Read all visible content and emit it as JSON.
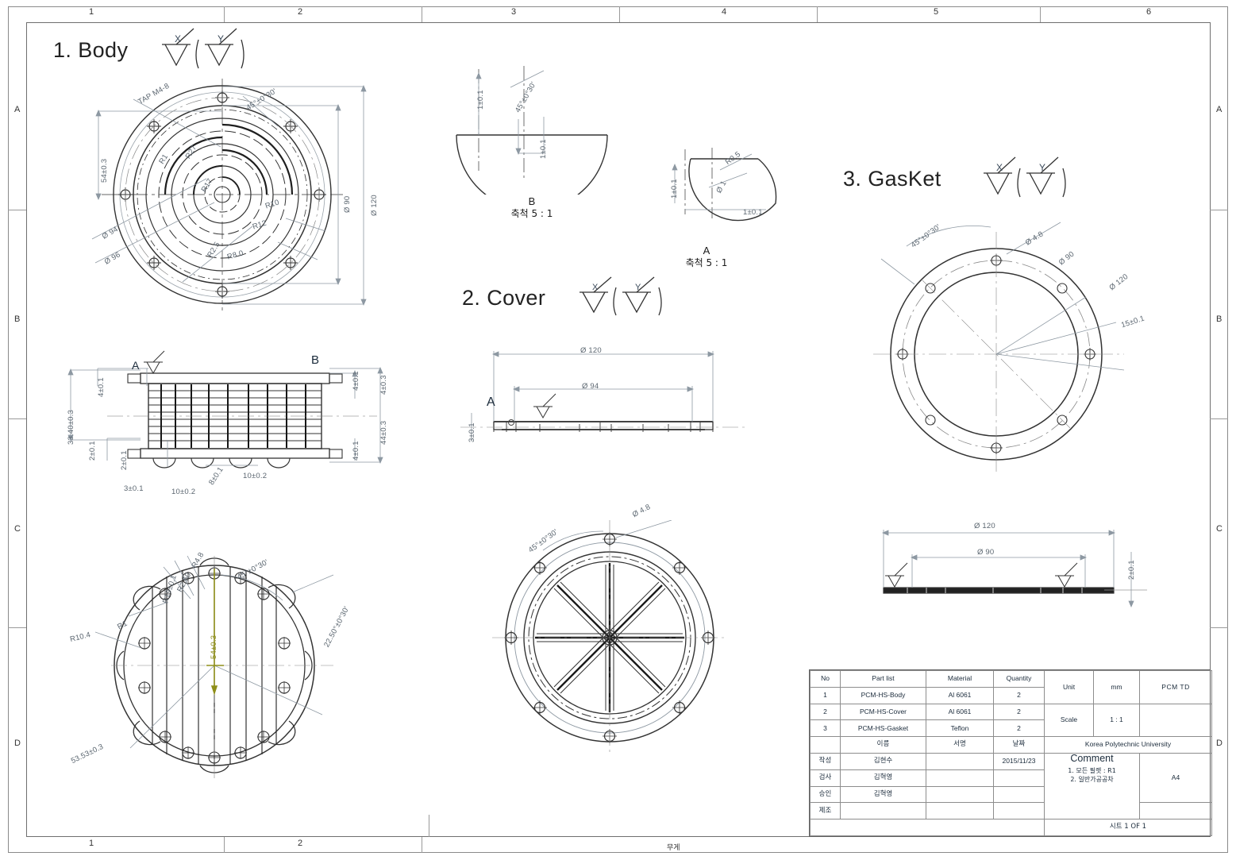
{
  "sheet": {
    "zone_cols": [
      "1",
      "2",
      "3",
      "4",
      "5",
      "6"
    ],
    "zone_rows": [
      "A",
      "B",
      "C",
      "D"
    ],
    "bottom_zone_cols": [
      "1",
      "2"
    ],
    "bottom_label": "무게"
  },
  "headings": {
    "body": "1. Body",
    "cover": "2. Cover",
    "gasket": "3. GasKet",
    "finish_x": "X",
    "finish_y": "Y"
  },
  "detail_views": {
    "b": {
      "letter": "B",
      "scale": "축척 5 : 1"
    },
    "a": {
      "letter": "A",
      "scale": "축척 5 : 1"
    }
  },
  "section_marks": {
    "body_section_a": "A",
    "body_section_b": "B",
    "cover_detail_a": "A"
  },
  "dimensions": {
    "body_top": [
      "TAP M4-8",
      "45°±0°30'",
      "54±0.3",
      "Ø 94",
      "Ø 96",
      "Ø 90",
      "Ø 120",
      "R27",
      "R17",
      "R10",
      "R12",
      "R2.5",
      "R1",
      "R8.0"
    ],
    "body_section": [
      "33.40±0.3",
      "4±0.1",
      "2±0.1",
      "2±0.1",
      "3±0.1",
      "10±0.2",
      "10±0.2",
      "4±0.1",
      "4±0.1",
      "4±0.3",
      "44±0.3",
      "8±0.1"
    ],
    "body_bottom": [
      "R19±0.1",
      "R2.50",
      "R4.8",
      "R1",
      "R10.4",
      "45°±0°30'",
      "22.50°±0°30'",
      "54±0.3",
      "53.53±0.3"
    ],
    "detail_b": [
      "1±0.1",
      "45°±0°30'",
      "1±0.1"
    ],
    "detail_a": [
      "1±0.1",
      "R0.5",
      "Ø 1",
      "1±0.1"
    ],
    "cover_section": [
      "Ø 120",
      "Ø 94",
      "3±0.1"
    ],
    "cover_bottom": [
      "Ø 4.8",
      "45°±0°30'"
    ],
    "gasket_top": [
      "45°±0°30'",
      "Ø 4.8",
      "Ø 90",
      "Ø 120",
      "15±0.1"
    ],
    "gasket_section": [
      "Ø 120",
      "Ø 90",
      "2±0.1"
    ]
  },
  "title_block": {
    "parts_header": [
      "No",
      "Part list",
      "Material",
      "Quantity"
    ],
    "parts": [
      {
        "no": "1",
        "name": "PCM-HS-Body",
        "material": "Al 6061",
        "qty": "2"
      },
      {
        "no": "2",
        "name": "PCM-HS-Cover",
        "material": "Al 6061",
        "qty": "2"
      },
      {
        "no": "3",
        "name": "PCM-HS-Gasket",
        "material": "Teflon",
        "qty": "2"
      }
    ],
    "sign_header": {
      "name": "이름",
      "sign": "서명",
      "date": "날짜"
    },
    "sign_rows": [
      {
        "role": "작성",
        "name": "김현수",
        "sign": "",
        "date": "2015/11/23"
      },
      {
        "role": "검사",
        "name": "김혁영",
        "sign": "",
        "date": ""
      },
      {
        "role": "승인",
        "name": "김혁영",
        "sign": "",
        "date": ""
      },
      {
        "role": "제조",
        "name": "",
        "sign": "",
        "date": ""
      }
    ],
    "unit_label": "Unit",
    "unit_value": "mm",
    "scale_label": "Scale",
    "scale_value": "1 : 1",
    "drawing_title": "PCM TD",
    "organization": "Korea Polytechnic University",
    "comment_title": "Comment",
    "comment_lines": [
      "1. 모든 필렛 : R1",
      "2. 일반가공공차"
    ],
    "paper_size": "A4",
    "sheet_label": "시트 1 OF 1"
  }
}
